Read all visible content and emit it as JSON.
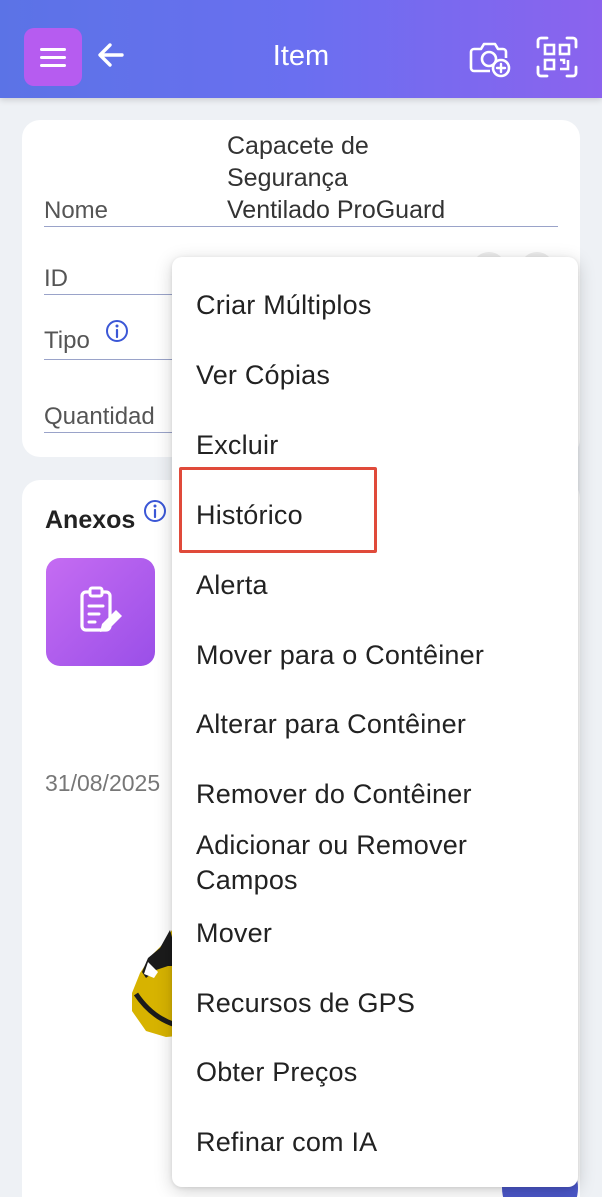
{
  "header": {
    "title": "Item",
    "menu_icon": "hamburger-icon",
    "back_icon": "arrow-left-icon",
    "camera_icon": "camera-add-icon",
    "scan_icon": "qr-scan-icon",
    "gradient_start": "#5b73e6",
    "gradient_end": "#8b63ee",
    "menu_button_color": "#b65cf0"
  },
  "details": {
    "name_label": "Nome",
    "name_value_lines": [
      "Capacete de",
      "Segurança",
      "Ventilado ProGuard"
    ],
    "id_label": "ID",
    "type_label": "Tipo",
    "quantity_label": "Quantidad"
  },
  "attachments": {
    "title": "Anexos",
    "tile_icon": "note-edit-icon",
    "date": "31/08/2025"
  },
  "menu": {
    "items": [
      "Criar Múltiplos",
      "Ver Cópias",
      "Excluir",
      "Histórico",
      "Alerta",
      "Mover para o Contêiner",
      "Alterar para Contêiner",
      "Remover do Contêiner",
      "Adicionar ou Remover Campos",
      "Mover",
      "Recursos de GPS",
      "Obter Preços",
      "Refinar com IA"
    ],
    "highlighted_item": "Histórico",
    "highlight_color": "#e04a3a"
  }
}
